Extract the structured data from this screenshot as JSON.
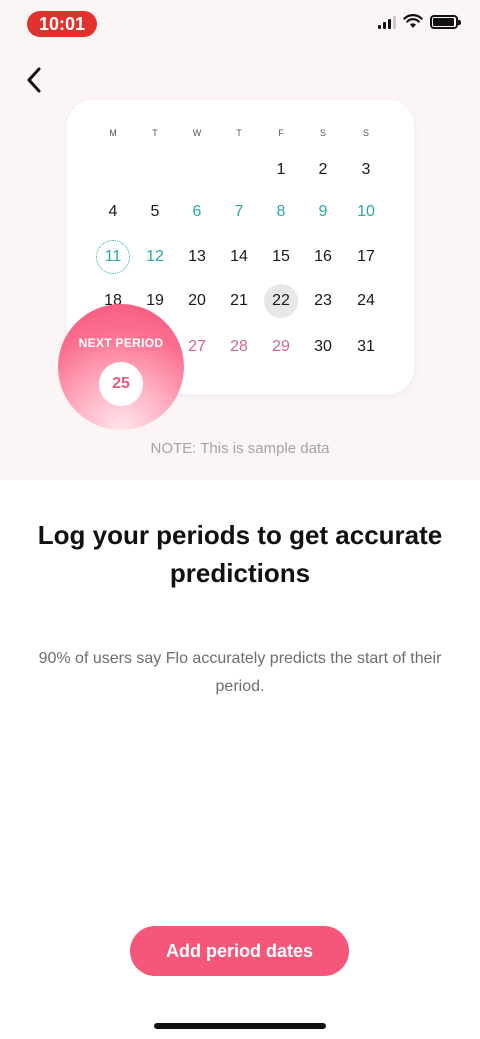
{
  "status_bar": {
    "time": "10:01"
  },
  "calendar": {
    "weekdays": [
      "M",
      "T",
      "W",
      "T",
      "F",
      "S",
      "S"
    ],
    "days": [
      {
        "label": "1",
        "col": 4,
        "row": 0,
        "kind": "normal"
      },
      {
        "label": "2",
        "col": 5,
        "row": 0,
        "kind": "normal"
      },
      {
        "label": "3",
        "col": 6,
        "row": 0,
        "kind": "normal"
      },
      {
        "label": "4",
        "col": 0,
        "row": 1,
        "kind": "normal"
      },
      {
        "label": "5",
        "col": 1,
        "row": 1,
        "kind": "normal"
      },
      {
        "label": "6",
        "col": 2,
        "row": 1,
        "kind": "fertile"
      },
      {
        "label": "7",
        "col": 3,
        "row": 1,
        "kind": "fertile"
      },
      {
        "label": "8",
        "col": 4,
        "row": 1,
        "kind": "fertile"
      },
      {
        "label": "9",
        "col": 5,
        "row": 1,
        "kind": "fertile"
      },
      {
        "label": "10",
        "col": 6,
        "row": 1,
        "kind": "fertile"
      },
      {
        "label": "11",
        "col": 0,
        "row": 2,
        "kind": "ovulation"
      },
      {
        "label": "12",
        "col": 1,
        "row": 2,
        "kind": "fertile"
      },
      {
        "label": "13",
        "col": 2,
        "row": 2,
        "kind": "normal"
      },
      {
        "label": "14",
        "col": 3,
        "row": 2,
        "kind": "normal"
      },
      {
        "label": "15",
        "col": 4,
        "row": 2,
        "kind": "normal"
      },
      {
        "label": "16",
        "col": 5,
        "row": 2,
        "kind": "normal"
      },
      {
        "label": "17",
        "col": 6,
        "row": 2,
        "kind": "normal"
      },
      {
        "label": "18",
        "col": 0,
        "row": 3,
        "kind": "normal"
      },
      {
        "label": "19",
        "col": 1,
        "row": 3,
        "kind": "normal"
      },
      {
        "label": "20",
        "col": 2,
        "row": 3,
        "kind": "normal"
      },
      {
        "label": "21",
        "col": 3,
        "row": 3,
        "kind": "normal"
      },
      {
        "label": "22",
        "col": 4,
        "row": 3,
        "kind": "today"
      },
      {
        "label": "23",
        "col": 5,
        "row": 3,
        "kind": "normal"
      },
      {
        "label": "24",
        "col": 6,
        "row": 3,
        "kind": "normal"
      },
      {
        "label": "27",
        "col": 2,
        "row": 4,
        "kind": "period"
      },
      {
        "label": "28",
        "col": 3,
        "row": 4,
        "kind": "period"
      },
      {
        "label": "29",
        "col": 4,
        "row": 4,
        "kind": "period"
      },
      {
        "label": "30",
        "col": 5,
        "row": 4,
        "kind": "normal"
      },
      {
        "label": "31",
        "col": 6,
        "row": 4,
        "kind": "normal"
      }
    ]
  },
  "next_period": {
    "label": "NEXT PERIOD",
    "day": "25"
  },
  "sample_note": "NOTE: This is sample data",
  "headline": "Log your periods to get accurate predictions",
  "subtext": "90% of users say Flo accurately predicts the start of their period.",
  "primary_button": {
    "label": "Add period dates"
  },
  "colors": {
    "accent": "#f5577b",
    "fertile": "#28a9a2",
    "period_text": "#d9658a",
    "status_pill": "#e0322c"
  },
  "icons": {
    "back": "chevron-left-icon",
    "signal": "cellular-signal-icon",
    "wifi": "wifi-icon",
    "battery": "battery-icon"
  }
}
